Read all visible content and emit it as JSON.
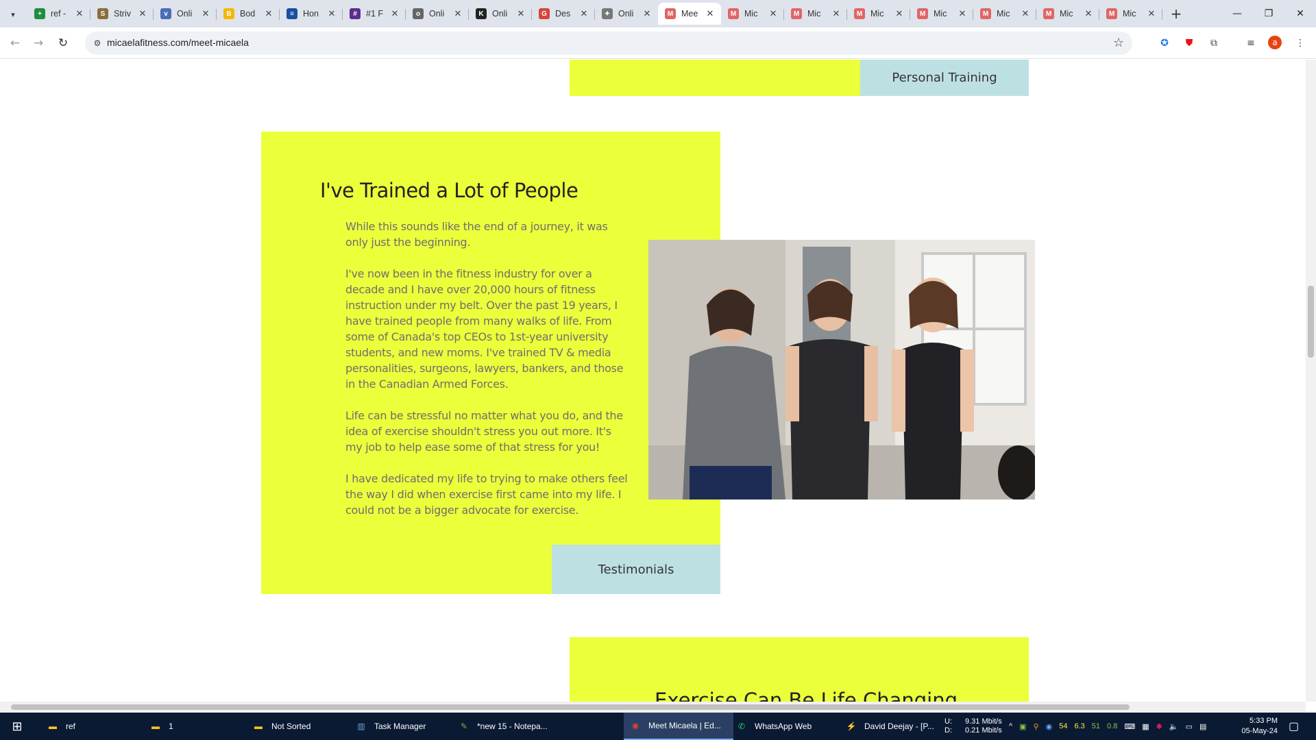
{
  "browser": {
    "tabs": [
      {
        "title": "ref -",
        "fav_color": "#1e8e3e",
        "fav_glyph": "+"
      },
      {
        "title": "Striv",
        "fav_color": "#8a6d3b",
        "fav_glyph": "S"
      },
      {
        "title": "Onli",
        "fav_color": "#4b6cb7",
        "fav_glyph": "v"
      },
      {
        "title": "Bod",
        "fav_color": "#f5b800",
        "fav_glyph": "B"
      },
      {
        "title": "Hon",
        "fav_color": "#1a4fa0",
        "fav_glyph": "≡"
      },
      {
        "title": "#1 F",
        "fav_color": "#5b2d8e",
        "fav_glyph": "#"
      },
      {
        "title": "Onli",
        "fav_color": "#666666",
        "fav_glyph": "o"
      },
      {
        "title": "Onli",
        "fav_color": "#222222",
        "fav_glyph": "K"
      },
      {
        "title": "Des",
        "fav_color": "#d44638",
        "fav_glyph": "G"
      },
      {
        "title": "Onli",
        "fav_color": "#777777",
        "fav_glyph": "✦"
      },
      {
        "title": "Mee",
        "fav_color": "#e06666",
        "fav_glyph": "M",
        "active": true
      },
      {
        "title": "Mic",
        "fav_color": "#e06666",
        "fav_glyph": "M"
      },
      {
        "title": "Mic",
        "fav_color": "#e06666",
        "fav_glyph": "M"
      },
      {
        "title": "Mic",
        "fav_color": "#e06666",
        "fav_glyph": "M"
      },
      {
        "title": "Mic",
        "fav_color": "#e06666",
        "fav_glyph": "M"
      },
      {
        "title": "Mic",
        "fav_color": "#e06666",
        "fav_glyph": "M"
      },
      {
        "title": "Mic",
        "fav_color": "#e06666",
        "fav_glyph": "M"
      },
      {
        "title": "Mic",
        "fav_color": "#e06666",
        "fav_glyph": "M"
      }
    ],
    "url": "micaelafitness.com/meet-micaela",
    "profile_initial": "a"
  },
  "page": {
    "top_button": "Personal Training",
    "heading": "I've Trained a Lot of People",
    "paragraphs": [
      "While this sounds like the end of a journey, it was only just the beginning.",
      "I've now been in the fitness industry for over a decade and I have over 20,000 hours of fitness instruction under my belt. Over the past 19 years, I have trained people from many walks of life. From some of Canada's top CEOs to 1st-year university students, and new moms. I've trained TV & media personalities, surgeons, lawyers, bankers, and those in the Canadian Armed Forces.",
      "Life can be stressful no matter what you do, and the idea of exercise shouldn't stress you out more. It's my job to help ease some of that stress for you!",
      "I have dedicated my life to trying to make others feel the way I did when exercise first came into my life. I could not be a bigger advocate for exercise."
    ],
    "testimonials_button": "Testimonials",
    "next_heading": "Exercise Can Be Life Changing",
    "accent_yellow": "#ebff3a",
    "accent_blue": "#bde0e3"
  },
  "taskbar": {
    "items": [
      {
        "label": "ref",
        "icon": "folder-icon"
      },
      {
        "label": "1",
        "icon": "folder-icon"
      },
      {
        "label": "Not Sorted",
        "icon": "folder-icon"
      },
      {
        "label": "Task Manager",
        "icon": "task-manager-icon"
      },
      {
        "label": "*new 15 - Notepa...",
        "icon": "notepad-icon"
      },
      {
        "label": "Meet Micaela | Ed...",
        "icon": "chrome-icon",
        "active": true
      },
      {
        "label": "WhatsApp Web",
        "icon": "whatsapp-icon"
      },
      {
        "label": "David Deejay - [P...",
        "icon": "winamp-icon"
      }
    ],
    "net_up_label": "U:",
    "net_down_label": "D:",
    "net_up": "9.31 Mbit/s",
    "net_down": "0.21 Mbit/s",
    "tray_nums": [
      "54",
      "6.3",
      "51",
      "0.8"
    ],
    "time": "5:33 PM",
    "date": "05-May-24"
  }
}
